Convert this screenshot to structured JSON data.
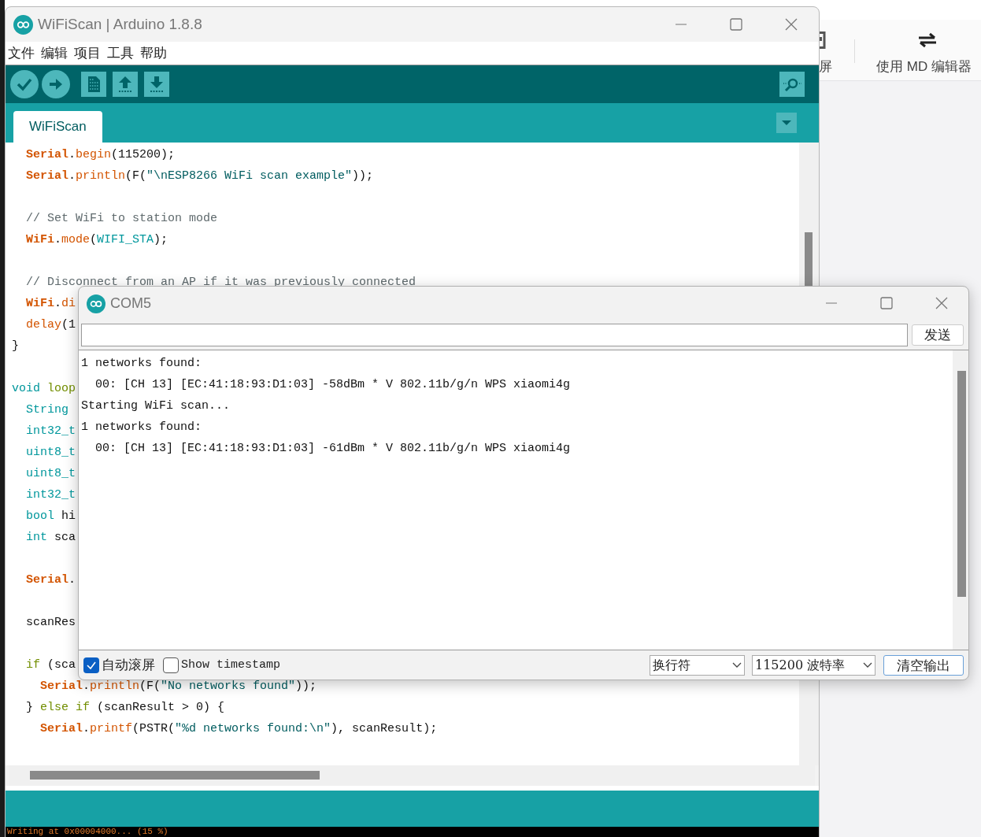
{
  "background_app": {
    "toolbar_items": [
      {
        "label": "屏"
      },
      {
        "label": "使用 MD 编辑器"
      }
    ]
  },
  "main_window": {
    "title": "WiFiScan | Arduino 1.8.8",
    "menu": [
      "文件",
      "编辑",
      "项目",
      "工具",
      "帮助"
    ],
    "tabs": [
      {
        "label": "WiFiScan",
        "selected": true
      }
    ],
    "code_blocks": [
      [
        [
          {
            "kind": "object",
            "text": "  Serial"
          },
          {
            "kind": "plain",
            "text": "."
          },
          {
            "kind": "function",
            "text": "begin"
          },
          {
            "kind": "plain",
            "text": "(115200);"
          }
        ],
        [
          {
            "kind": "object",
            "text": "  Serial"
          },
          {
            "kind": "plain",
            "text": "."
          },
          {
            "kind": "function",
            "text": "println"
          },
          {
            "kind": "plain",
            "text": "(F("
          },
          {
            "kind": "string",
            "text": "\"\\nESP8266 WiFi scan example\""
          },
          {
            "kind": "plain",
            "text": "));"
          }
        ]
      ],
      [
        [
          {
            "kind": "comment",
            "text": "  // Set WiFi to station mode"
          }
        ],
        [
          {
            "kind": "object",
            "text": "  WiFi"
          },
          {
            "kind": "plain",
            "text": "."
          },
          {
            "kind": "function",
            "text": "mode"
          },
          {
            "kind": "plain",
            "text": "("
          },
          {
            "kind": "constant",
            "text": "WIFI_STA"
          },
          {
            "kind": "plain",
            "text": ");"
          }
        ]
      ],
      [
        [
          {
            "kind": "comment",
            "text": "  // Disconnect from an AP if it was previously connected"
          }
        ],
        [
          {
            "kind": "object",
            "text": "  WiFi"
          },
          {
            "kind": "plain",
            "text": "."
          },
          {
            "kind": "function",
            "text": "di"
          }
        ],
        [
          {
            "kind": "function",
            "text": "  delay"
          },
          {
            "kind": "plain",
            "text": "(1"
          }
        ],
        [
          {
            "kind": "plain",
            "text": "}"
          }
        ]
      ],
      [
        [
          {
            "kind": "type",
            "text": "void"
          },
          {
            "kind": "keyword",
            "text": " loop"
          }
        ],
        [
          {
            "kind": "type",
            "text": "  String"
          }
        ],
        [
          {
            "kind": "type",
            "text": "  int32_t"
          }
        ],
        [
          {
            "kind": "type",
            "text": "  uint8_t"
          }
        ],
        [
          {
            "kind": "type",
            "text": "  uint8_t"
          }
        ],
        [
          {
            "kind": "type",
            "text": "  int32_t"
          }
        ],
        [
          {
            "kind": "type",
            "text": "  bool"
          },
          {
            "kind": "plain",
            "text": " hi"
          }
        ],
        [
          {
            "kind": "type",
            "text": "  int"
          },
          {
            "kind": "plain",
            "text": " sca"
          }
        ]
      ],
      [
        [
          {
            "kind": "object",
            "text": "  Serial"
          },
          {
            "kind": "plain",
            "text": "."
          }
        ]
      ],
      [
        [
          {
            "kind": "plain",
            "text": "  scanRes"
          }
        ]
      ],
      [
        [
          {
            "kind": "keyword",
            "text": "  if"
          },
          {
            "kind": "plain",
            "text": " (sca"
          }
        ],
        [
          {
            "kind": "object",
            "text": "    Serial"
          },
          {
            "kind": "plain",
            "text": "."
          },
          {
            "kind": "function",
            "text": "println"
          },
          {
            "kind": "plain",
            "text": "(F("
          },
          {
            "kind": "string",
            "text": "\"No networks found\""
          },
          {
            "kind": "plain",
            "text": "));"
          }
        ],
        [
          {
            "kind": "plain",
            "text": "  } "
          },
          {
            "kind": "keyword",
            "text": "else if"
          },
          {
            "kind": "plain",
            "text": " (scanResult > 0) {"
          }
        ],
        [
          {
            "kind": "object",
            "text": "    Serial"
          },
          {
            "kind": "plain",
            "text": "."
          },
          {
            "kind": "function",
            "text": "printf"
          },
          {
            "kind": "plain",
            "text": "(PSTR("
          },
          {
            "kind": "string",
            "text": "\"%d networks found:\\n\""
          },
          {
            "kind": "plain",
            "text": "), scanResult);"
          }
        ]
      ]
    ],
    "console": "Writing at 0x00004000... (15 %)"
  },
  "serial_monitor": {
    "title": "COM5",
    "send_button": "发送",
    "output_lines": [
      "1 networks found:",
      "  00: [CH 13] [EC:41:18:93:D1:03] -58dBm * V 802.11b/g/n WPS xiaomi4g",
      "Starting WiFi scan...",
      "1 networks found:",
      "  00: [CH 13] [EC:41:18:93:D1:03] -61dBm * V 802.11b/g/n WPS xiaomi4g"
    ],
    "options": [
      {
        "label": "自动滚屏",
        "checked": true
      },
      {
        "label": "Show timestamp",
        "checked": false
      }
    ],
    "line_ending": "换行符",
    "baud_rate": "115200 波特率",
    "clear_button": "清空输出"
  }
}
